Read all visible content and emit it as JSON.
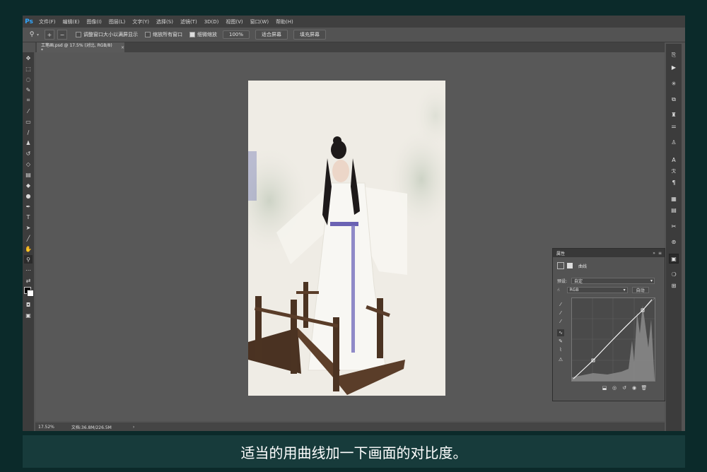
{
  "app": {
    "logo": "Ps"
  },
  "menu": [
    "文件(F)",
    "编辑(E)",
    "图像(I)",
    "图层(L)",
    "文字(Y)",
    "选择(S)",
    "滤镜(T)",
    "3D(D)",
    "视图(V)",
    "窗口(W)",
    "帮助(H)"
  ],
  "options": {
    "resize_windows": "调整窗口大小以满屏显示",
    "zoom_all": "缩放所有窗口",
    "scrubby_zoom": "细微缩放",
    "zoom_100": "100%",
    "fit_screen": "适合屏幕",
    "fill_screen": "填充屏幕"
  },
  "document_tab": {
    "title": "工笔画.psd @ 17.5% (对比, RGB/8) *",
    "close": "×"
  },
  "status": {
    "zoom": "17.52%",
    "doc": "文档:36.8M/226.5M",
    "arrow": "›"
  },
  "properties": {
    "panel_title": "属性",
    "layer_type": "曲线",
    "preset_label": "预设:",
    "preset_value": "自定",
    "channel_value": "RGB",
    "auto_button": "自动"
  },
  "caption": "适当的用曲线加一下画面的对比度。",
  "colors": {
    "accent": "#31a8ff",
    "caption_bg": "#173b3b",
    "canvas_bg": "#585858",
    "sash": "#6b63b3"
  }
}
